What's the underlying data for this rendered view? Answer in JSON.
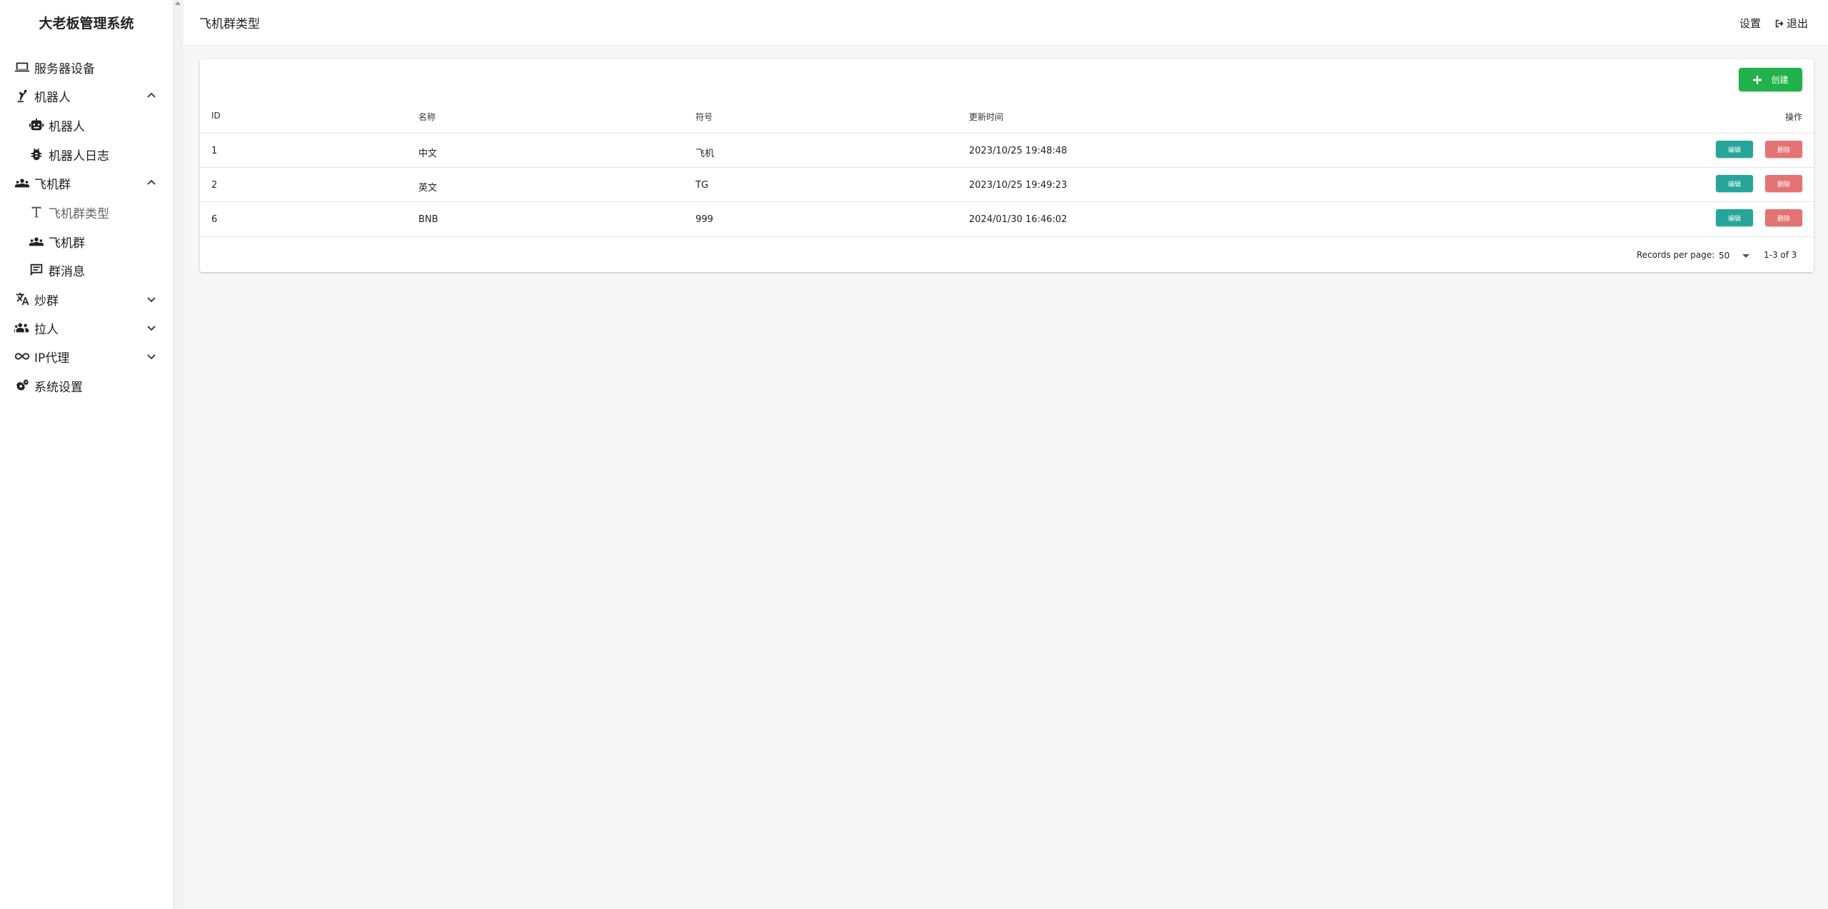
{
  "app": {
    "brand": "大老板管理系统"
  },
  "sidebar": {
    "items": [
      {
        "label": "服务器设备",
        "icon": "laptop-icon"
      },
      {
        "label": "机器人",
        "icon": "robot-arm-icon",
        "expanded": true
      },
      {
        "label": "机器人",
        "icon": "robot-icon"
      },
      {
        "label": "机器人日志",
        "icon": "bug-icon"
      },
      {
        "label": "飞机群",
        "icon": "group-icon",
        "expanded": true
      },
      {
        "label": "飞机群类型",
        "icon": "text-type-icon",
        "active": true
      },
      {
        "label": "飞机群",
        "icon": "group-icon"
      },
      {
        "label": "群消息",
        "icon": "message-icon"
      },
      {
        "label": "炒群",
        "icon": "translate-icon",
        "expanded": false
      },
      {
        "label": "拉人",
        "icon": "people-icon",
        "expanded": false
      },
      {
        "label": "IP代理",
        "icon": "infinity-icon",
        "expanded": false
      },
      {
        "label": "系统设置",
        "icon": "gears-icon"
      }
    ]
  },
  "header": {
    "title": "飞机群类型",
    "settings_label": "设置",
    "logout_label": "退出"
  },
  "toolbar": {
    "create_label": "创建"
  },
  "table": {
    "columns": [
      "ID",
      "名称",
      "符号",
      "更新时间",
      "操作"
    ],
    "rows": [
      {
        "id": "1",
        "name": "中文",
        "symbol": "飞机",
        "updated": "2023/10/25 19:48:48",
        "edit": "编辑",
        "delete": "删除"
      },
      {
        "id": "2",
        "name": "英文",
        "symbol": "TG",
        "updated": "2023/10/25 19:49:23",
        "edit": "编辑",
        "delete": "删除"
      },
      {
        "id": "6",
        "name": "BNB",
        "symbol": "999",
        "updated": "2024/01/30 16:46:02",
        "edit": "编辑",
        "delete": "删除"
      }
    ]
  },
  "pagination": {
    "records_per_page_label": "Records per page:",
    "per_page_value": "50",
    "range": "1-3 of 3"
  },
  "colors": {
    "create": "#21b24b",
    "edit": "#26a69a",
    "delete": "#e57373"
  }
}
